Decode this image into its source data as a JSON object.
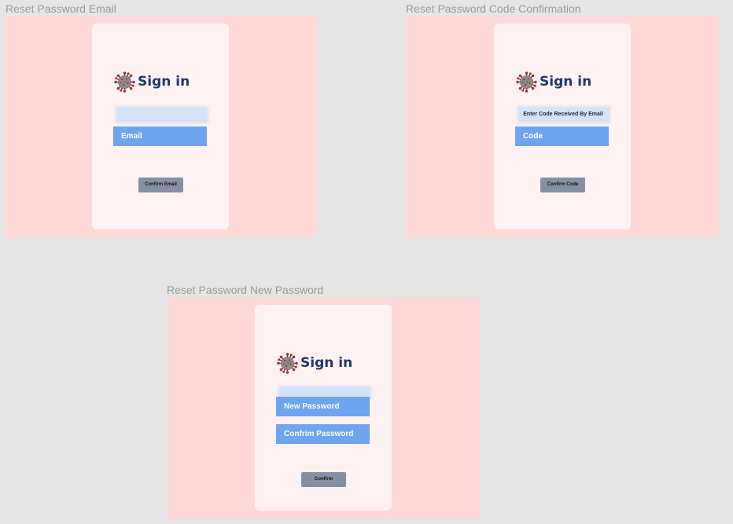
{
  "frames": {
    "email": {
      "label": "Reset Password Email",
      "title": "Sign in",
      "field_label": "Email",
      "button_label": "Confirm Email"
    },
    "code": {
      "label": "Reset Password Code Confirmation",
      "title": "Sign in",
      "instruction": "Enter Code Received By Email",
      "field_label": "Code",
      "button_label": "Confirm Code"
    },
    "new_password": {
      "label": "Reset Password New Password",
      "title": "Sign in",
      "new_password_label": "New Password",
      "confirm_password_label": "Confrim Password",
      "button_label": "Confirm"
    }
  },
  "icons": {
    "brand": "virus-icon"
  },
  "colors": {
    "canvas": "#e5e5e5",
    "frame_background": "#ffd8d8",
    "card_background": "#fff2f2",
    "input_fill": "#6ea4f0",
    "title_text": "#1b3a6b",
    "button_fill": "#8690a5"
  }
}
